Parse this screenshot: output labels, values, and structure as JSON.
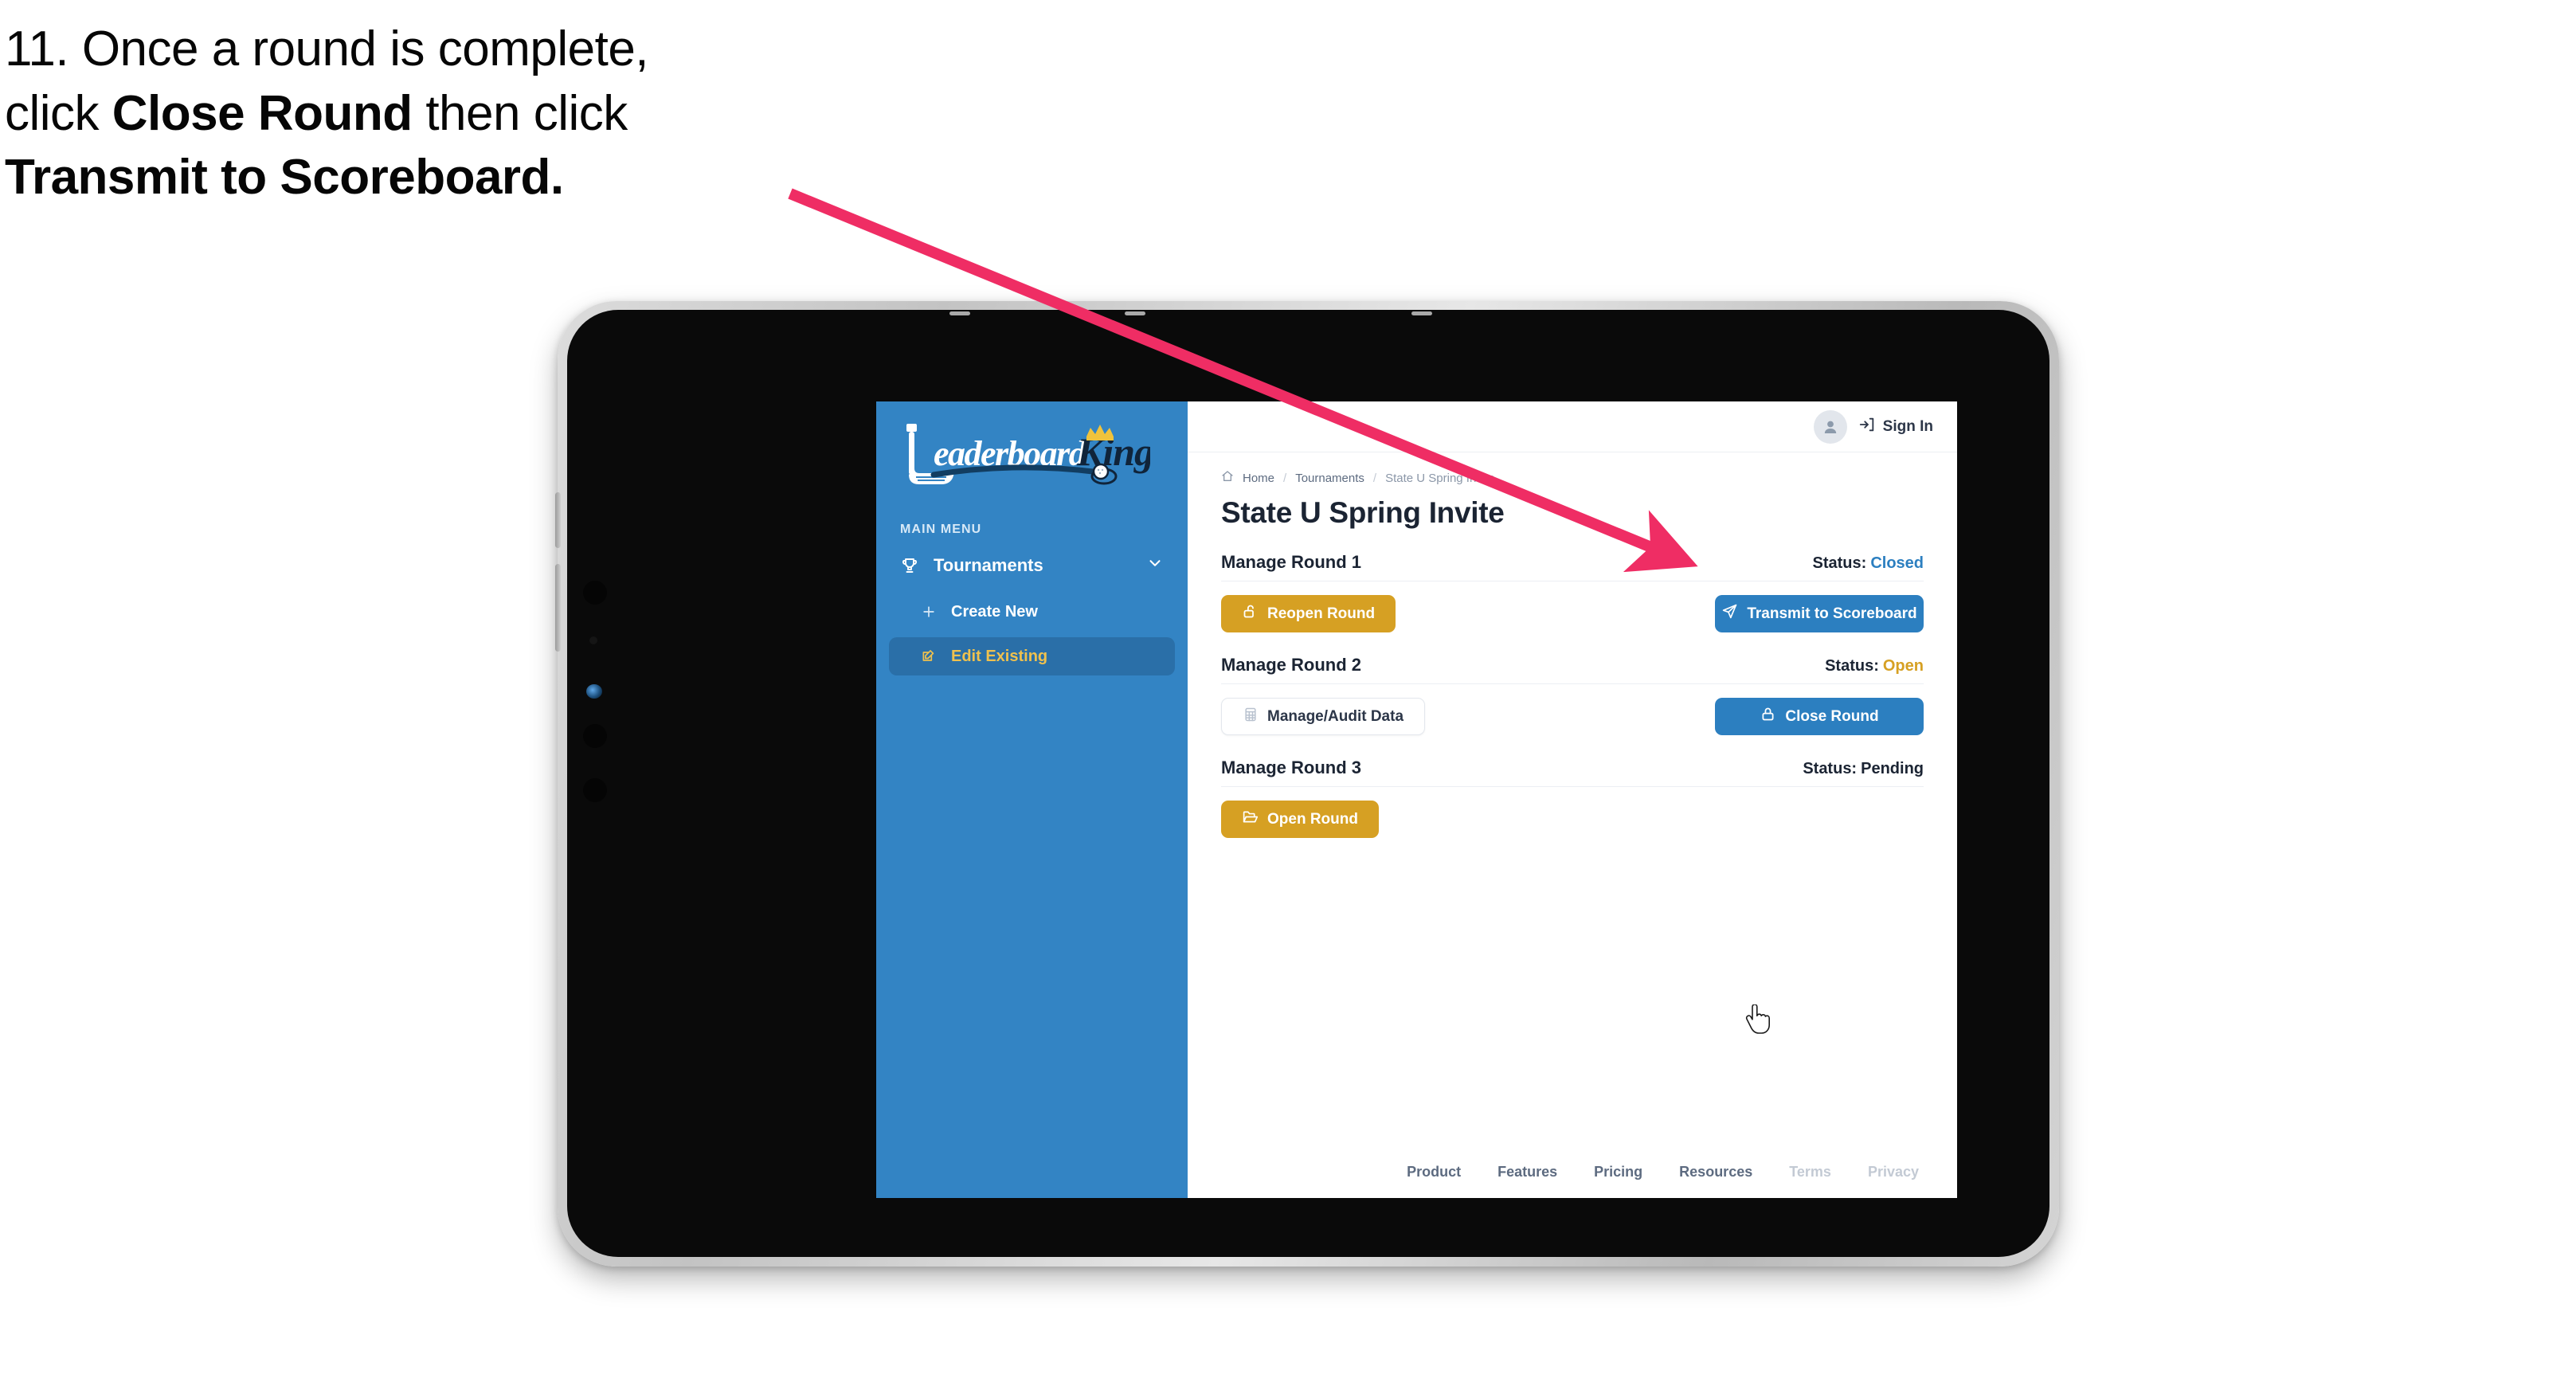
{
  "caption": {
    "line1_prefix": "11. Once a round is complete,",
    "line2_prefix": "click ",
    "line2_bold": "Close Round",
    "line2_suffix": " then click",
    "line3_bold": "Transmit to Scoreboard."
  },
  "colors": {
    "sidebar_blue": "#3384c4",
    "sidebar_active": "#2a6fa8",
    "gold": "#d6a023",
    "blue_button": "#2c7fc0",
    "status_closed": "#2c7fc0",
    "status_open": "#d6a023",
    "status_pending": "#1b2433",
    "arrow_pink": "#ef2d64",
    "accent_gold_text": "#efc14e"
  },
  "sidebar": {
    "logo": {
      "word_primary": "Leaderboard",
      "word_secondary": "King",
      "icon_putter": "golf-putter-icon",
      "icon_crown": "crown-icon",
      "icon_golfball": "golf-ball-icon"
    },
    "section_label": "MAIN MENU",
    "nav": [
      {
        "label": "Tournaments",
        "icon": "trophy-icon",
        "chevron": "chevron-down-icon",
        "active": false
      },
      {
        "label": "Create New",
        "icon": "plus-icon",
        "active": false
      },
      {
        "label": "Edit Existing",
        "icon": "edit-square-icon",
        "active": true
      }
    ]
  },
  "topbar": {
    "avatar_icon": "user-avatar-icon",
    "signin_icon": "sign-in-icon",
    "signin_label": "Sign In"
  },
  "breadcrumb": {
    "home_icon": "home-icon",
    "items": [
      "Home",
      "Tournaments",
      "State U Spring Invite"
    ],
    "separator": "/"
  },
  "page": {
    "title": "State U Spring Invite"
  },
  "rounds": [
    {
      "title": "Manage Round 1",
      "status_label": "Status:",
      "status_value": "Closed",
      "status_color": "#2c7fc0",
      "left_button": {
        "label": "Reopen Round",
        "icon": "unlock-icon",
        "style": "gold"
      },
      "right_button": {
        "label": "Transmit to Scoreboard",
        "icon": "send-icon",
        "style": "blue"
      }
    },
    {
      "title": "Manage Round 2",
      "status_label": "Status:",
      "status_value": "Open",
      "status_color": "#d6a023",
      "left_button": {
        "label": "Manage/Audit Data",
        "icon": "table-grid-icon",
        "style": "ghost"
      },
      "right_button": {
        "label": "Close Round",
        "icon": "lock-icon",
        "style": "blue"
      }
    },
    {
      "title": "Manage Round 3",
      "status_label": "Status:",
      "status_value": "Pending",
      "status_color": "#1b2433",
      "left_button": {
        "label": "Open Round",
        "icon": "folder-open-icon",
        "style": "gold"
      },
      "right_button": null
    }
  ],
  "footer": {
    "links": [
      {
        "label": "Product",
        "dim": false
      },
      {
        "label": "Features",
        "dim": false
      },
      {
        "label": "Pricing",
        "dim": false
      },
      {
        "label": "Resources",
        "dim": false
      },
      {
        "label": "Terms",
        "dim": true
      },
      {
        "label": "Privacy",
        "dim": true
      }
    ]
  },
  "annotation": {
    "arrow": "pointer-arrow",
    "target": "transmit-to-scoreboard-button"
  },
  "cursor": {
    "type": "pointing-hand-cursor"
  }
}
